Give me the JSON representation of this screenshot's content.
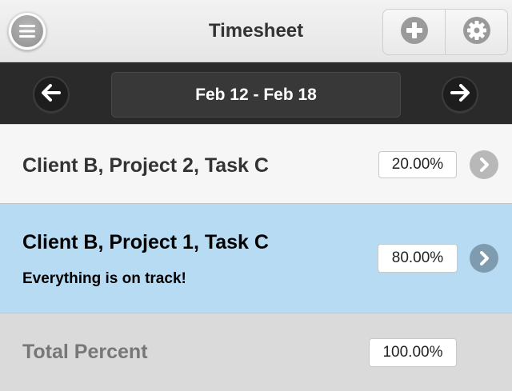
{
  "header": {
    "title": "Timesheet",
    "menu_icon": "hamburger-menu-icon",
    "add_icon": "plus-circle-icon",
    "settings_icon": "gear-icon"
  },
  "week_nav": {
    "range_label": "Feb 12 - Feb 18",
    "prev_icon": "arrow-left-icon",
    "next_icon": "arrow-right-icon"
  },
  "entries": [
    {
      "title": "Client B, Project 2, Task C",
      "percent": "20.00%",
      "note": ""
    },
    {
      "title": "Client B, Project 1, Task C",
      "percent": "80.00%",
      "note": "Everything is on track!"
    }
  ],
  "total": {
    "label": "Total Percent",
    "percent": "100.00%"
  },
  "colors": {
    "selected_row": "#b6dbf3",
    "nav_bar": "#2a2a2a",
    "total_row": "#dadada"
  }
}
